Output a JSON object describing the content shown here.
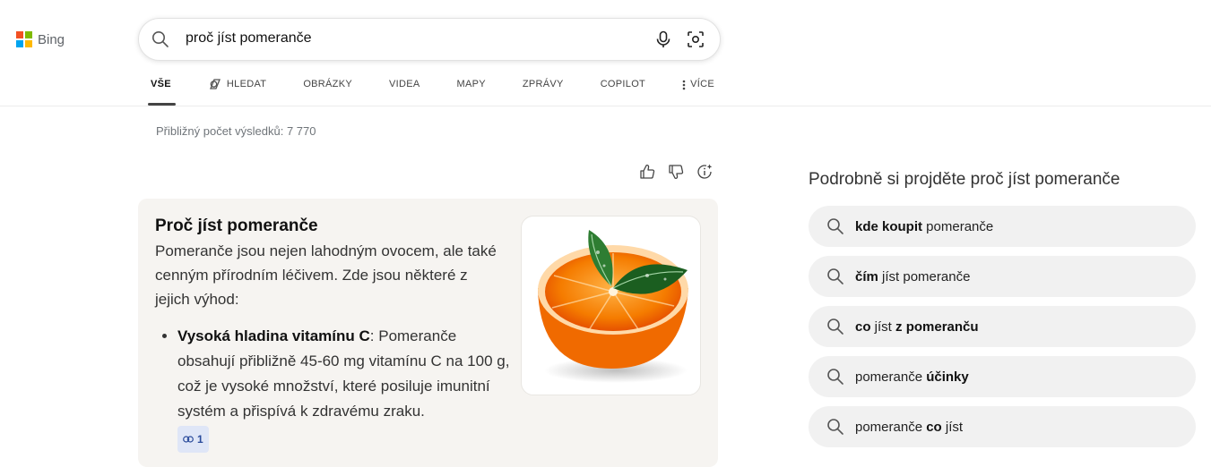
{
  "brand": {
    "name": "Bing",
    "logo_colors": [
      "#f25022",
      "#7fba00",
      "#00a4ef",
      "#ffb900"
    ]
  },
  "search": {
    "query": "proč jíst pomeranče",
    "icons": [
      "search-icon",
      "microphone-icon",
      "visual-search-icon"
    ]
  },
  "tabs": [
    {
      "label": "VŠE",
      "active": true
    },
    {
      "label": "HLEDAT",
      "icon": "copilot-search-icon"
    },
    {
      "label": "OBRÁZKY"
    },
    {
      "label": "VIDEA"
    },
    {
      "label": "MAPY"
    },
    {
      "label": "ZPRÁVY"
    },
    {
      "label": "COPILOT"
    },
    {
      "label": "VÍCE",
      "icon": "more-vertical-icon"
    }
  ],
  "results_count": "Přibližný počet výsledků: 7 770",
  "feedback_icons": [
    "thumbs-up-icon",
    "thumbs-down-icon",
    "sparkle-info-icon"
  ],
  "answer": {
    "title": "Proč jíst pomeranče",
    "intro": "Pomeranče jsou nejen lahodným ovocem, ale také cenným přírodním léčivem. Zde jsou některé z jejich výhod:",
    "bullets": [
      {
        "bold": "Vysoká hladina vitamínu C",
        "text": ": Pomeranče obsahují přibližně 45-60 mg vitamínu C na 100 g, což je vysoké množství, které posiluje imunitní systém a přispívá k zdravému zraku.",
        "citation": "1"
      }
    ],
    "image": "halved-orange-with-leaves"
  },
  "related": {
    "title": "Podrobně si projděte proč jíst pomeranče",
    "items": [
      {
        "parts": [
          {
            "t": "kde koupit",
            "b": true
          },
          {
            "t": " pomeranče",
            "b": false
          }
        ]
      },
      {
        "parts": [
          {
            "t": "čím",
            "b": true
          },
          {
            "t": " jíst pomeranče",
            "b": false
          }
        ]
      },
      {
        "parts": [
          {
            "t": "co",
            "b": true
          },
          {
            "t": " jíst ",
            "b": false
          },
          {
            "t": "z pomeranču",
            "b": true
          }
        ]
      },
      {
        "parts": [
          {
            "t": "pomeranče ",
            "b": false
          },
          {
            "t": "účinky",
            "b": true
          }
        ]
      },
      {
        "parts": [
          {
            "t": "pomeranče ",
            "b": false
          },
          {
            "t": "co",
            "b": true
          },
          {
            "t": " jíst",
            "b": false
          }
        ]
      }
    ]
  }
}
